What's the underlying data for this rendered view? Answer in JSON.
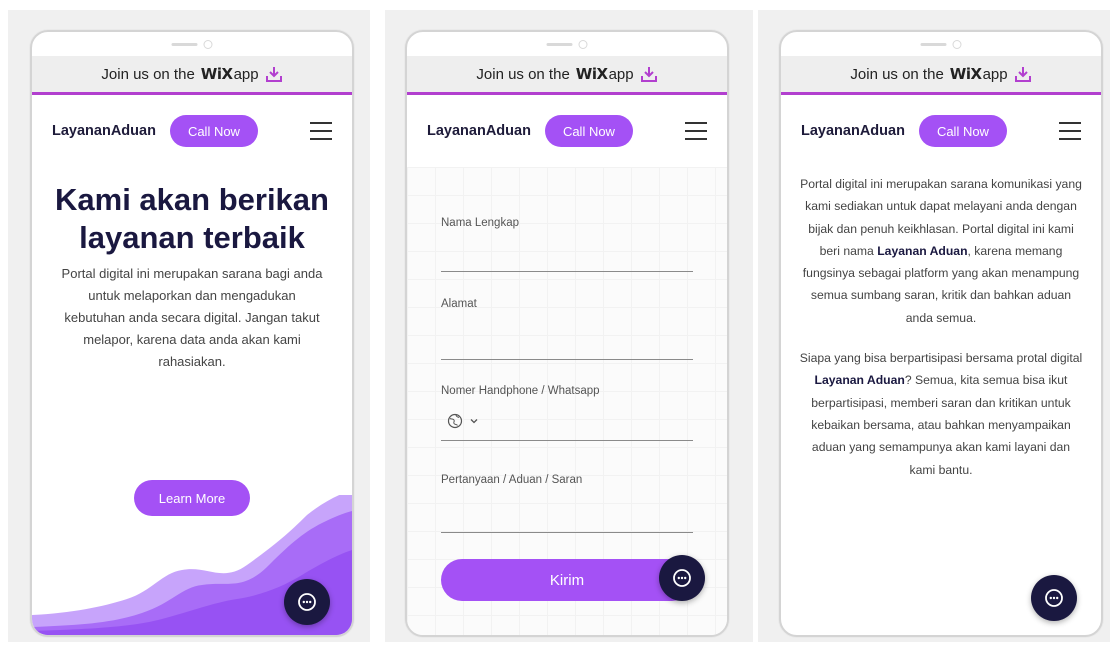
{
  "banner": {
    "join_text": "Join us on the",
    "wix_logo": "WiX",
    "app_text": "app"
  },
  "nav": {
    "brand": "LayananAduan",
    "call_label": "Call Now"
  },
  "screen1": {
    "hero_title": "Kami akan berikan layanan terbaik",
    "hero_text": "Portal digital ini merupakan sarana bagi anda untuk melaporkan dan mengadukan kebutuhan anda secara digital. Jangan takut melapor, karena data anda akan kami rahasiakan.",
    "learn_label": "Learn More"
  },
  "screen2": {
    "fields": {
      "name": "Nama Lengkap",
      "address": "Alamat",
      "phone": "Nomer Handphone / Whatsapp",
      "message": "Pertanyaan / Aduan / Saran"
    },
    "submit_label": "Kirim"
  },
  "screen3": {
    "p1_a": "Portal digital ini merupakan sarana komunikasi yang kami sediakan untuk dapat melayani anda dengan bijak dan penuh keikhlasan. Portal digital ini kami beri nama ",
    "p1_b": "Layanan Aduan",
    "p1_c": ", karena memang fungsinya sebagai platform yang akan menampung semua sumbang saran, kritik dan bahkan aduan anda semua.",
    "p2_a": "Siapa yang bisa berpartisipasi bersama protal digital ",
    "p2_b": "Layanan Aduan",
    "p2_c": "? Semua, kita semua bisa ikut berpartisipasi, memberi saran dan kritikan untuk kebaikan bersama, atau bahkan menyampaikan aduan yang semampunya akan kami layani dan kami bantu."
  },
  "colors": {
    "accent": "#a451f5",
    "dark": "#1a1840",
    "banner_line": "#b23fcf"
  },
  "icons": [
    "download-icon",
    "menu-icon",
    "chat-icon",
    "globe-icon",
    "chevron-down-icon"
  ]
}
